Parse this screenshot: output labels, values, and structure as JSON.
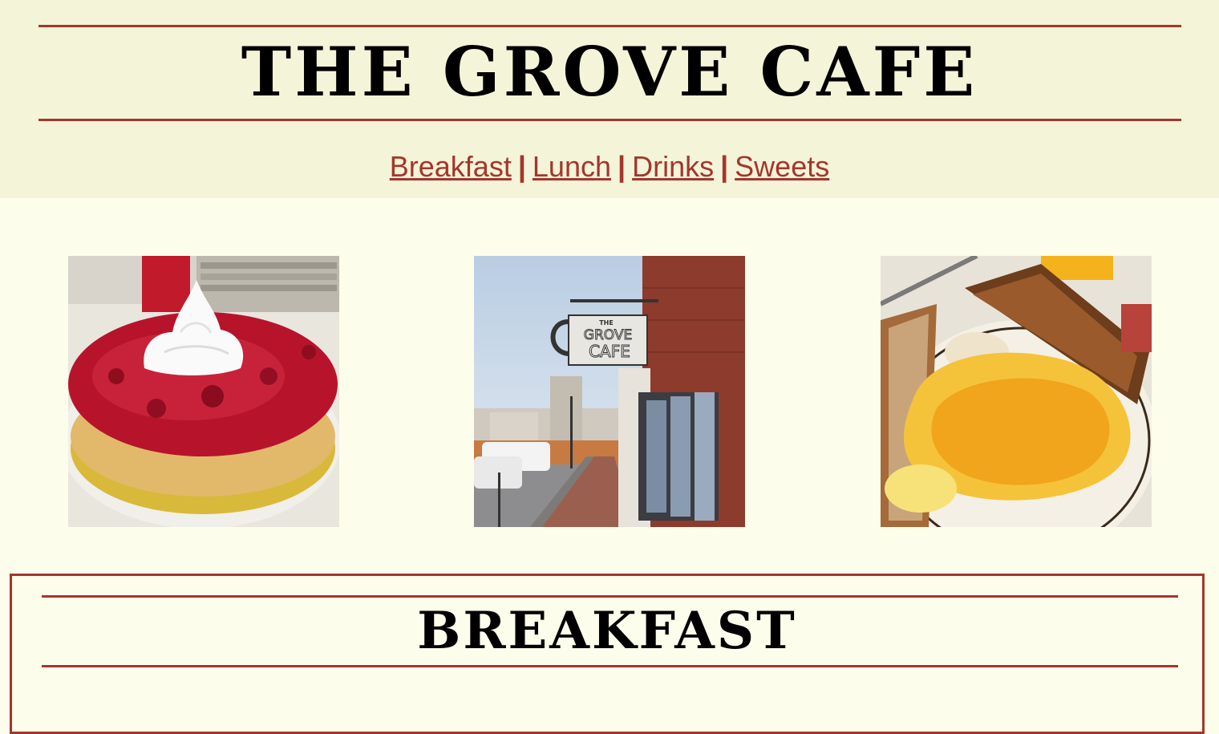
{
  "header": {
    "title": "THE GROVE CAFE"
  },
  "nav": {
    "items": [
      {
        "label": "Breakfast"
      },
      {
        "label": "Lunch"
      },
      {
        "label": "Drinks"
      },
      {
        "label": "Sweets"
      }
    ],
    "separator": "|"
  },
  "gallery": {
    "photos": [
      {
        "subject": "pancake-with-berry-compote-and-whipped-cream"
      },
      {
        "subject": "cafe-storefront-sign-on-sidewalk",
        "sign_text_top": "THE",
        "sign_text_mid": "GROVE",
        "sign_text_bottom": "CAFE"
      },
      {
        "subject": "eggs-with-cheese-and-toast"
      }
    ]
  },
  "section": {
    "title": "BREAKFAST"
  },
  "colors": {
    "accent": "#a4362b",
    "header_bg": "#f4f4d9",
    "page_bg": "#fdfdeb"
  }
}
